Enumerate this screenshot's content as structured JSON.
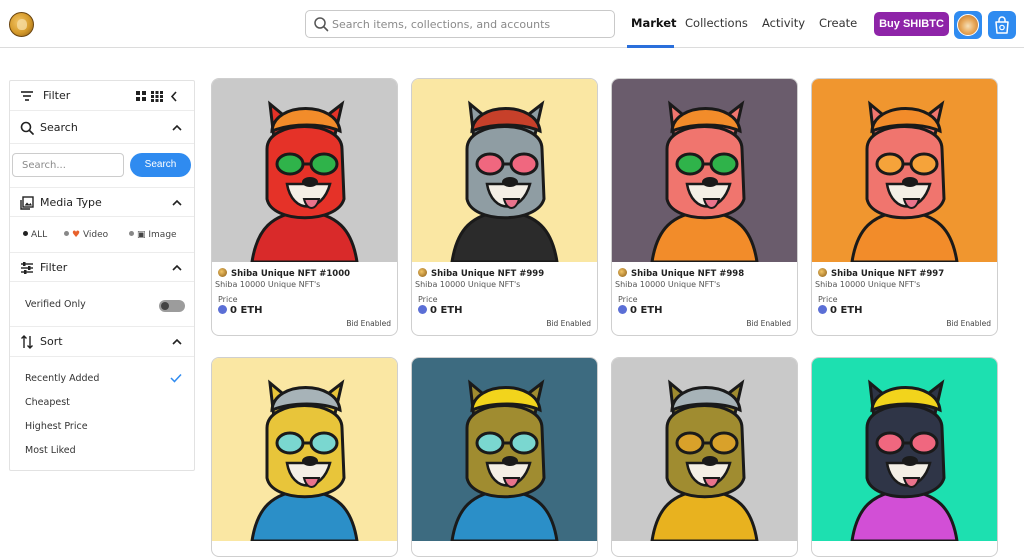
{
  "header": {
    "search_placeholder": "Search items, collections, and accounts",
    "nav": [
      "Market",
      "Collections",
      "Activity",
      "Create"
    ],
    "active_nav": "Market",
    "buy_label": "Buy SHIBTC",
    "accent_color": "#2f8bf0",
    "buy_color": "#8e24a8"
  },
  "sidebar": {
    "filter_header": "Filter",
    "search_section": "Search",
    "search_placeholder": "Search...",
    "search_button": "Search",
    "media_type_section": "Media Type",
    "media_options": [
      "ALL",
      "Video",
      "Image"
    ],
    "media_selected": "ALL",
    "filter_section": "Filter",
    "verified_only_label": "Verified Only",
    "verified_only_on": false,
    "sort_section": "Sort",
    "sort_options": [
      "Recently Added",
      "Cheapest",
      "Highest Price",
      "Most Liked"
    ],
    "sort_selected": "Recently Added"
  },
  "cards": [
    {
      "title": "Shiba Unique NFT #1000",
      "collection": "Shiba 10000 Unique NFT's",
      "price_label": "Price",
      "price": "0 ETH",
      "status": "Bid Enabled",
      "bg": "#c9c9c9",
      "fur": "#e53228",
      "accessory": "orange-tiger-hat, green-glasses, red-hoodie"
    },
    {
      "title": "Shiba Unique NFT #999",
      "collection": "Shiba 10000 Unique NFT's",
      "price_label": "Price",
      "price": "0 ETH",
      "status": "Bid Enabled",
      "bg": "#fae7a3",
      "fur": "#8f9da3",
      "accessory": "red-mohawk, heart-glasses, black-bandana"
    },
    {
      "title": "Shiba Unique NFT #998",
      "collection": "Shiba 10000 Unique NFT's",
      "price_label": "Price",
      "price": "0 ETH",
      "status": "Bid Enabled",
      "bg": "#6a5c6c",
      "fur": "#f0756e",
      "accessory": "orange-tiger-hat, green-glasses"
    },
    {
      "title": "Shiba Unique NFT #997",
      "collection": "Shiba 10000 Unique NFT's",
      "price_label": "Price",
      "price": "0 ETH",
      "status": "Bid Enabled",
      "bg": "#f0962f",
      "fur": "#f0756e",
      "accessory": "orange-tiger-hat, orange-glasses, orange-shirt"
    },
    {
      "bg": "#fae7a3",
      "fur": "#e8c53a",
      "accessory": "grey-cap, monocle, overalls"
    },
    {
      "bg": "#3d6b80",
      "fur": "#a08c30",
      "accessory": "yellow-hat, monocle, overalls"
    },
    {
      "bg": "#c9c9c9",
      "fur": "#a08c30",
      "accessory": "grey-cap, x-glasses, fur-coat"
    },
    {
      "bg": "#1de0b0",
      "fur": "#2f3547",
      "accessory": "yellow-hat, heart-glasses, pink-hoodie"
    }
  ]
}
